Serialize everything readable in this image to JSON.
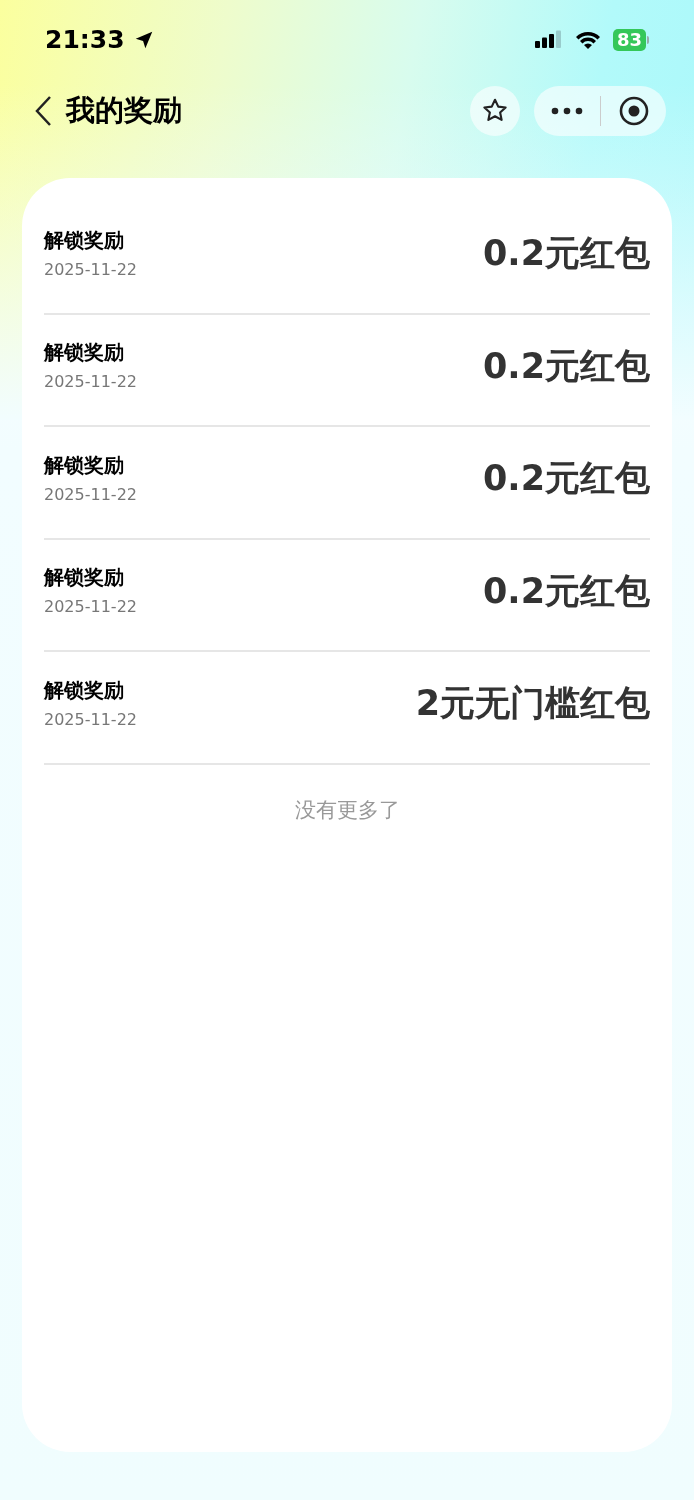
{
  "status_bar": {
    "time": "21:33",
    "battery": "83"
  },
  "header": {
    "title": "我的奖励"
  },
  "rewards": [
    {
      "title": "解锁奖励",
      "date": "2025-11-22",
      "amount": "0.2元红包"
    },
    {
      "title": "解锁奖励",
      "date": "2025-11-22",
      "amount": "0.2元红包"
    },
    {
      "title": "解锁奖励",
      "date": "2025-11-22",
      "amount": "0.2元红包"
    },
    {
      "title": "解锁奖励",
      "date": "2025-11-22",
      "amount": "0.2元红包"
    },
    {
      "title": "解锁奖励",
      "date": "2025-11-22",
      "amount": "2元无门槛红包"
    }
  ],
  "end_note": "没有更多了"
}
